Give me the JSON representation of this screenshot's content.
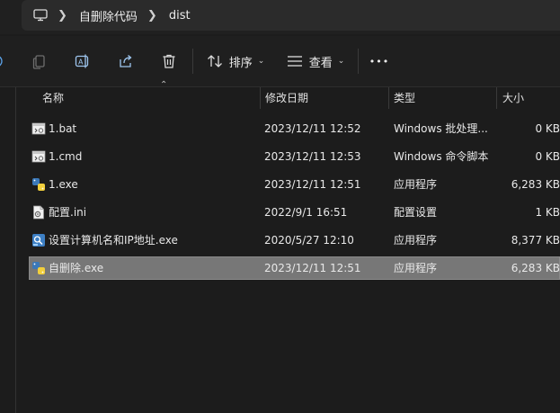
{
  "breadcrumb": {
    "items": [
      "自删除代码",
      "dist"
    ]
  },
  "toolbar": {
    "sort_label": "排序",
    "view_label": "查看",
    "more_label": "•••"
  },
  "columns": {
    "name": "名称",
    "modified": "修改日期",
    "type": "类型",
    "size": "大小"
  },
  "files": [
    {
      "name": "1.bat",
      "modified": "2023/12/11 12:52",
      "type": "Windows 批处理...",
      "size": "0 KB",
      "icon": "batch-file-icon",
      "selected": false
    },
    {
      "name": "1.cmd",
      "modified": "2023/12/11 12:53",
      "type": "Windows 命令脚本",
      "size": "0 KB",
      "icon": "batch-file-icon",
      "selected": false
    },
    {
      "name": "1.exe",
      "modified": "2023/12/11 12:51",
      "type": "应用程序",
      "size": "6,283 KB",
      "icon": "python-exe-icon",
      "selected": false
    },
    {
      "name": "配置.ini",
      "modified": "2022/9/1 16:51",
      "type": "配置设置",
      "size": "1 KB",
      "icon": "ini-file-icon",
      "selected": false
    },
    {
      "name": "设置计算机名和IP地址.exe",
      "modified": "2020/5/27 12:10",
      "type": "应用程序",
      "size": "8,377 KB",
      "icon": "app-exe-icon",
      "selected": false
    },
    {
      "name": "自删除.exe",
      "modified": "2023/12/11 12:51",
      "type": "应用程序",
      "size": "6,283 KB",
      "icon": "python-exe-icon",
      "selected": true
    }
  ],
  "colors": {
    "background": "#1c1c1c",
    "selected_row": "#777777",
    "text": "#e8e8e8"
  }
}
